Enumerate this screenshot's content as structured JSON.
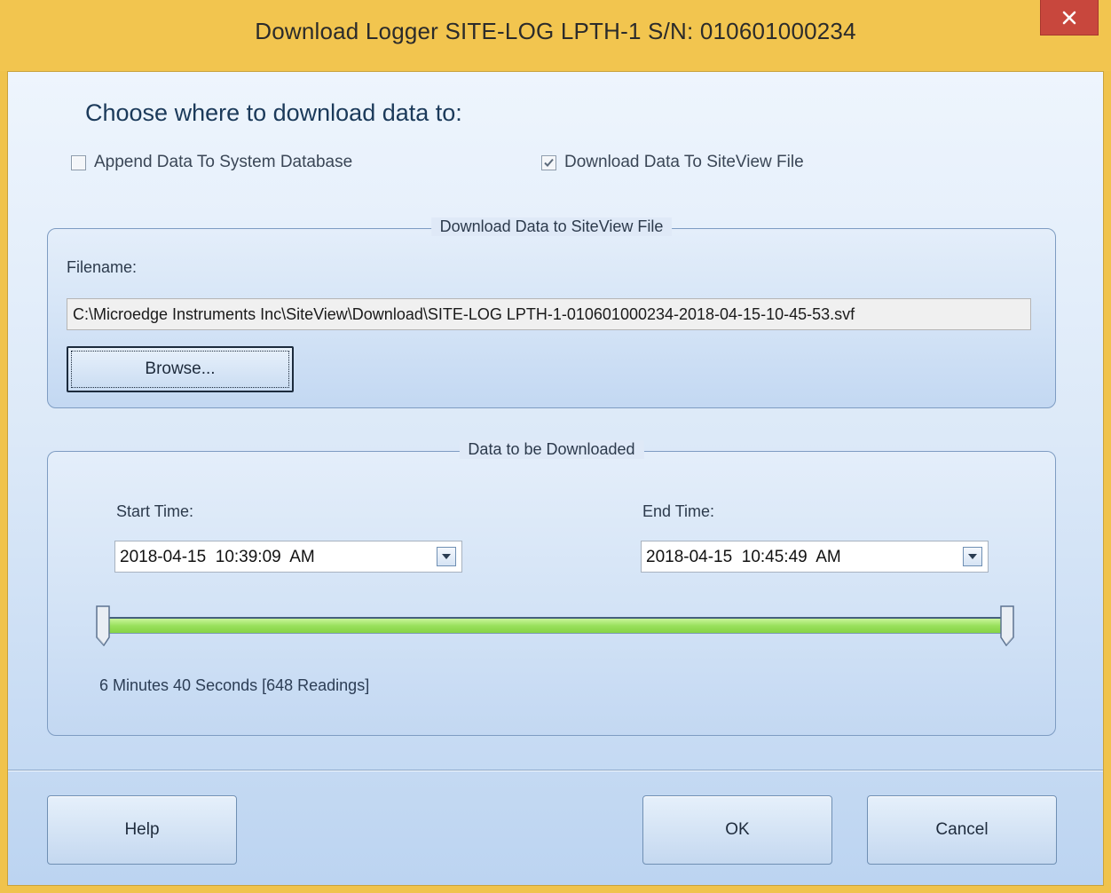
{
  "window": {
    "title": "Download Logger SITE-LOG LPTH-1 S/N: 010601000234"
  },
  "destination": {
    "heading": "Choose where to download data to:",
    "append_label": "Append Data To System Database",
    "append_checked": false,
    "siteview_label": "Download Data To SiteView File",
    "siteview_checked": true
  },
  "file_group": {
    "legend": "Download Data to SiteView File",
    "filename_label": "Filename:",
    "filename_value": "C:\\Microedge Instruments Inc\\SiteView\\Download\\SITE-LOG LPTH-1-010601000234-2018-04-15-10-45-53.svf",
    "browse_label": "Browse..."
  },
  "data_group": {
    "legend": "Data to be Downloaded",
    "start_label": "Start Time:",
    "start_value": "2018-04-15  10:39:09  AM",
    "end_label": "End Time:",
    "end_value": "2018-04-15  10:45:49  AM",
    "range_start_fraction": 0.0,
    "range_end_fraction": 1.0,
    "duration_text": "6 Minutes 40 Seconds [648 Readings]"
  },
  "footer": {
    "help_label": "Help",
    "ok_label": "OK",
    "cancel_label": "Cancel"
  },
  "colors": {
    "frame": "#f0c34c",
    "close_button": "#c8473d",
    "range_fill": "#99e05c"
  }
}
